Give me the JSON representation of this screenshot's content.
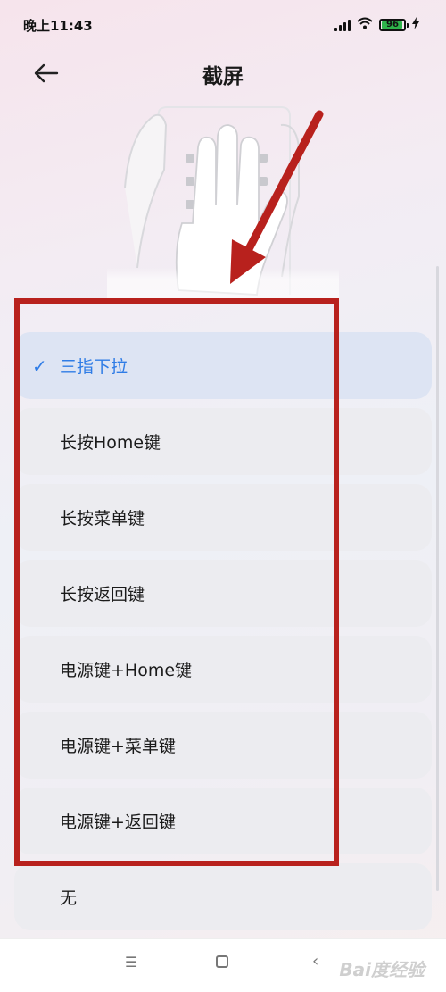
{
  "status_bar": {
    "time": "晚上11:43",
    "battery_level": "96",
    "battery_percent": 96,
    "icons": [
      "signal-icon",
      "wifi-icon",
      "battery-icon",
      "charging-icon"
    ]
  },
  "header": {
    "title": "截屏",
    "back_icon": "arrow-left-icon"
  },
  "options": [
    {
      "label": "三指下拉",
      "selected": true
    },
    {
      "label": "长按Home键",
      "selected": false
    },
    {
      "label": "长按菜单键",
      "selected": false
    },
    {
      "label": "长按返回键",
      "selected": false
    },
    {
      "label": "电源键+Home键",
      "selected": false
    },
    {
      "label": "电源键+菜单键",
      "selected": false
    },
    {
      "label": "电源键+返回键",
      "selected": false
    },
    {
      "label": "无",
      "selected": false
    }
  ],
  "check_mark": "✓",
  "nav_bar": {
    "menu_glyph": "☰",
    "back_glyph": "‹"
  },
  "watermark": "Bai度经验",
  "colors": {
    "accent": "#2f7ce6",
    "highlight_border": "#b8211d",
    "battery_fill": "#2eb44a",
    "selected_bg": "#dde4f3",
    "option_bg": "#ececf0"
  }
}
